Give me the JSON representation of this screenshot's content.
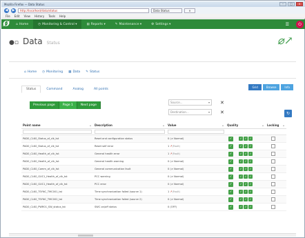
{
  "browser": {
    "window_title": "Mozilla Firefox — Data Status",
    "url": "http://localhost/data/status",
    "tab1": "Data Status",
    "tab2": "×",
    "menu": [
      "File",
      "Edit",
      "View",
      "History",
      "Tools",
      "Help"
    ]
  },
  "appnav": {
    "logo": "Ø",
    "items": [
      {
        "label": "Home"
      },
      {
        "label": "Monitoring & Control ▾"
      },
      {
        "label": "Reports ▾"
      },
      {
        "label": "Maintenance ▾"
      },
      {
        "label": "Settings ▾"
      }
    ]
  },
  "page": {
    "title": "Data",
    "subtitle": "Status"
  },
  "subnav": [
    {
      "icon": "⌂",
      "label": "Home"
    },
    {
      "icon": "◷",
      "label": "Monitoring"
    },
    {
      "icon": "▦",
      "label": "Data"
    },
    {
      "icon": "✎",
      "label": "Status"
    }
  ],
  "tabs": [
    "Status",
    "Command",
    "Analog",
    "All points"
  ],
  "view_buttons": [
    "Grid",
    "Browse",
    "Info"
  ],
  "pager": [
    "Previous page",
    "Page 1",
    "Next page"
  ],
  "filters": [
    {
      "placeholder": "Source..."
    },
    {
      "placeholder": "Destination..."
    }
  ],
  "table": {
    "headers": [
      "Point name",
      "Description",
      "Value",
      "Quality",
      "Locking"
    ],
    "rows": [
      {
        "name": "PAD0_CLK0_Status_of_clk_tst",
        "desc": "Reset and configuration status",
        "value": "0 (≠ Normal)",
        "alarm": false
      },
      {
        "name": "PAD0_CLK0_Status_of_clk_tst",
        "desc": "Reset self error",
        "value": "1",
        "suffix": "(Fault)",
        "alarm": true
      },
      {
        "name": "PAD0_CLK0_Health_of_clk_tst",
        "desc": "General health error",
        "value": "1",
        "suffix": "(Fault)",
        "alarm": true
      },
      {
        "name": "PAD0_CLK0_Health_of_clk_tst",
        "desc": "General health warning",
        "value": "0 (≠ Normal)",
        "alarm": false
      },
      {
        "name": "PAD0_CLK0_Comm_of_clk_tst",
        "desc": "General communication fault",
        "value": "0 (≠ Normal)",
        "alarm": false
      },
      {
        "name": "PAD0_CLK0_GUC1_Health_of_clk_tst",
        "desc": "PCC warning",
        "value": "0 (≠ Normal)",
        "alarm": false
      },
      {
        "name": "PAD0_CLK0_GUC1_Health_of_clk_tst",
        "desc": "PCC error",
        "value": "0 (≠ Normal)",
        "alarm": false
      },
      {
        "name": "PAD0_CLK0_TSYNC_TMC001_tst",
        "desc": "Time synchronization failed (source 1)",
        "value": "1",
        "suffix": "(Fault)",
        "alarm": true
      },
      {
        "name": "PAD0_CLK0_TSYNC_TMC002_tst",
        "desc": "Time synchronization failed (source 2)",
        "value": "0 (≠ Normal)",
        "alarm": false
      },
      {
        "name": "PAD0_CLK0_PWR01_SW_status_tst",
        "desc": "SWC on/off status",
        "value": "0 (OFF)",
        "alarm": false
      }
    ]
  },
  "colors": {
    "nav_green": "#2e8b3a",
    "quality_green": "#43a047",
    "link_blue": "#2b6cb0",
    "power_red": "#d0104c"
  }
}
